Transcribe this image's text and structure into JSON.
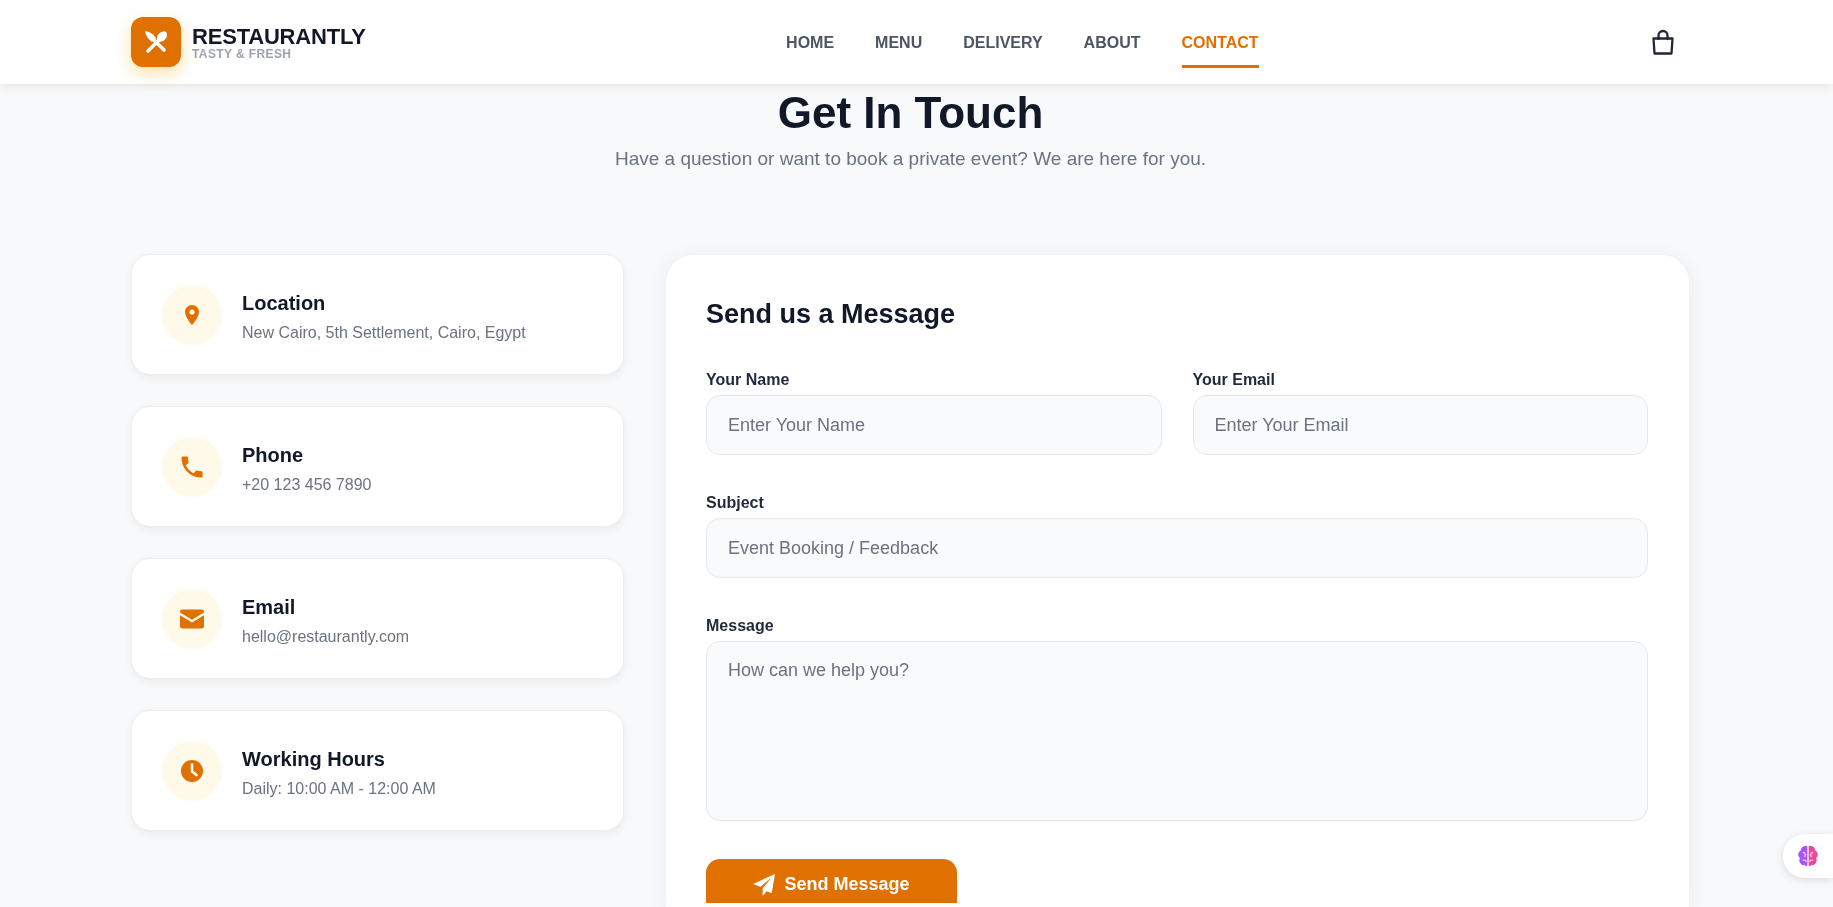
{
  "header": {
    "brand": {
      "name": "RESTAURANTLY",
      "tagline": "TASTY & FRESH"
    },
    "nav": [
      {
        "label": "HOME",
        "selected": false
      },
      {
        "label": "MENU",
        "selected": false
      },
      {
        "label": "DELIVERY",
        "selected": false
      },
      {
        "label": "ABOUT",
        "selected": false
      },
      {
        "label": "CONTACT",
        "selected": true
      }
    ]
  },
  "hero": {
    "title": "Get In Touch",
    "subtitle": "Have a question or want to book a private event? We are here for you."
  },
  "contact_cards": [
    {
      "kind": "location",
      "title": "Location",
      "detail": "New Cairo, 5th Settlement, Cairo, Egypt"
    },
    {
      "kind": "phone",
      "title": "Phone",
      "detail": "+20 123 456 7890"
    },
    {
      "kind": "email",
      "title": "Email",
      "detail": "hello@restaurantly.com"
    },
    {
      "kind": "hours",
      "title": "Working Hours",
      "detail": "Daily: 10:00 AM - 12:00 AM"
    }
  ],
  "form": {
    "title": "Send us a Message",
    "rows": [
      {
        "fields": [
          {
            "kind": "input",
            "label": "Your Name",
            "placeholder": "Enter Your Name"
          },
          {
            "kind": "input",
            "label": "Your Email",
            "placeholder": "Enter Your Email"
          }
        ]
      },
      {
        "fields": [
          {
            "kind": "input",
            "label": "Subject",
            "placeholder": "Event Booking / Feedback"
          }
        ]
      },
      {
        "fields": [
          {
            "kind": "textarea",
            "label": "Message",
            "placeholder": "How can we help you?"
          }
        ]
      }
    ],
    "submit": {
      "label": "Send Message"
    }
  }
}
